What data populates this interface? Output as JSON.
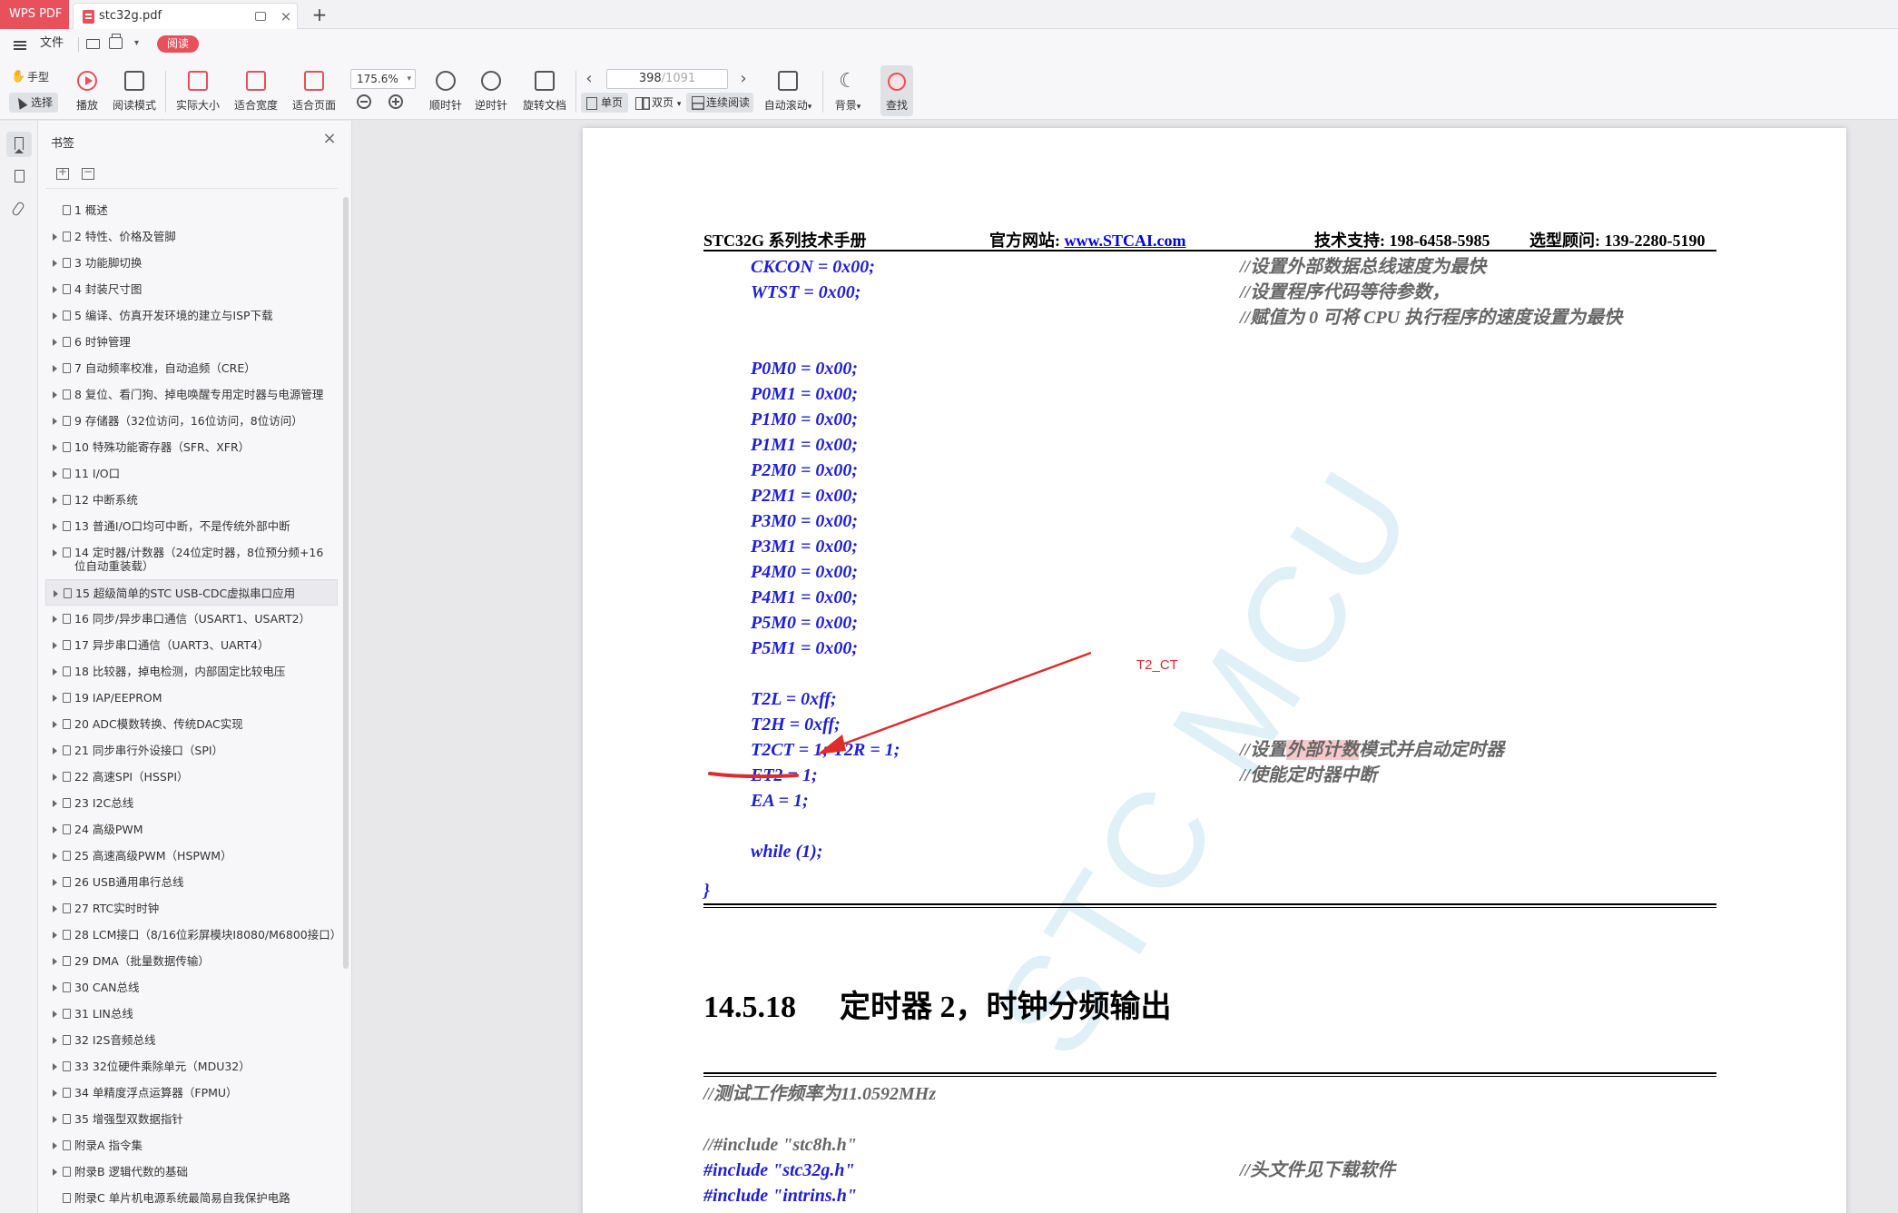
{
  "titlebar": {
    "app_tab": "WPS PDF",
    "doc_tab": "stc32g.pdf",
    "close_glyph": "×",
    "new_tab_glyph": "+"
  },
  "menubar": {
    "file": "文件",
    "read_badge": "阅读"
  },
  "toolbar": {
    "hand": "手型",
    "select": "选择",
    "play": "播放",
    "read_mode": "阅读模式",
    "actual_size": "实际大小",
    "fit_width": "适合宽度",
    "fit_page": "适合页面",
    "zoom_level": "175.6%",
    "rotate_cw": "顺时针",
    "rotate_ccw": "逆时针",
    "rotate_doc": "旋转文档",
    "current_page": "398",
    "total_pages": "/1091",
    "single_page": "单页",
    "double_page": "双页",
    "continuous": "连续阅读",
    "auto_scroll": "自动滚动",
    "background": "背景",
    "find": "查找",
    "dropdown_glyph": "▾",
    "prev_glyph": "‹",
    "next_glyph": "›"
  },
  "bookmarks": {
    "title": "书签",
    "close_glyph": "×",
    "items": [
      {
        "label": "1 概述",
        "expandable": false
      },
      {
        "label": "2 特性、价格及管脚",
        "expandable": true
      },
      {
        "label": "3 功能脚切换",
        "expandable": true
      },
      {
        "label": "4 封装尺寸图",
        "expandable": true
      },
      {
        "label": "5 编译、仿真开发环境的建立与ISP下载",
        "expandable": true
      },
      {
        "label": "6 时钟管理",
        "expandable": true
      },
      {
        "label": "7 自动频率校准，自动追频（CRE）",
        "expandable": true
      },
      {
        "label": "8 复位、看门狗、掉电唤醒专用定时器与电源管理",
        "expandable": true
      },
      {
        "label": "9 存储器（32位访问，16位访问，8位访问）",
        "expandable": true
      },
      {
        "label": "10 特殊功能寄存器（SFR、XFR）",
        "expandable": true
      },
      {
        "label": "11 I/O口",
        "expandable": true
      },
      {
        "label": "12 中断系统",
        "expandable": true
      },
      {
        "label": "13 普通I/O口均可中断，不是传统外部中断",
        "expandable": true
      },
      {
        "label": "14 定时器/计数器（24位定时器，8位预分频+16位自动重装载）",
        "expandable": true
      },
      {
        "label": "15 超级简单的STC USB-CDC虚拟串口应用",
        "expandable": true
      },
      {
        "label": "16 同步/异步串口通信（USART1、USART2）",
        "expandable": true
      },
      {
        "label": "17 异步串口通信（UART3、UART4）",
        "expandable": true
      },
      {
        "label": "18 比较器，掉电检测，内部固定比较电压",
        "expandable": true
      },
      {
        "label": "19 IAP/EEPROM",
        "expandable": true
      },
      {
        "label": "20 ADC模数转换、传统DAC实现",
        "expandable": true
      },
      {
        "label": "21 同步串行外设接口（SPI）",
        "expandable": true
      },
      {
        "label": "22 高速SPI（HSSPI）",
        "expandable": true
      },
      {
        "label": "23 I2C总线",
        "expandable": true
      },
      {
        "label": "24 高级PWM",
        "expandable": true
      },
      {
        "label": "25 高速高级PWM（HSPWM）",
        "expandable": true
      },
      {
        "label": "26 USB通用串行总线",
        "expandable": true
      },
      {
        "label": "27 RTC实时时钟",
        "expandable": true
      },
      {
        "label": "28 LCM接口（8/16位彩屏模块I8080/M6800接口）",
        "expandable": true
      },
      {
        "label": "29 DMA（批量数据传输）",
        "expandable": true
      },
      {
        "label": "30 CAN总线",
        "expandable": true
      },
      {
        "label": "31 LIN总线",
        "expandable": true
      },
      {
        "label": "32 I2S音频总线",
        "expandable": true
      },
      {
        "label": "33 32位硬件乘除单元（MDU32）",
        "expandable": true
      },
      {
        "label": "34 单精度浮点运算器（FPMU）",
        "expandable": true
      },
      {
        "label": "35 增强型双数据指针",
        "expandable": true
      },
      {
        "label": "附录A 指令集",
        "expandable": true
      },
      {
        "label": "附录B 逻辑代数的基础",
        "expandable": true
      },
      {
        "label": "附录C 单片机电源系统最简易自我保护电路",
        "expandable": false
      }
    ]
  },
  "document": {
    "header": {
      "title": "STC32G 系列技术手册",
      "website_label": "官方网站: ",
      "website_url": "www.STCAI.com",
      "support": "技术支持: 198-6458-5985",
      "advisor": "选型顾问: 139-2280-5190"
    },
    "code_lines": [
      {
        "code": "CKCON = 0x00;",
        "comment": "//设置外部数据总线速度为最快"
      },
      {
        "code": "WTST = 0x00;",
        "comment": "//设置程序代码等待参数，"
      },
      {
        "code": "",
        "comment": "//赋值为 0 可将 CPU 执行程序的速度设置为最快"
      },
      {
        "code": "P0M0 = 0x00;"
      },
      {
        "code": "P0M1 = 0x00;"
      },
      {
        "code": "P1M0 = 0x00;"
      },
      {
        "code": "P1M1 = 0x00;"
      },
      {
        "code": "P2M0 = 0x00;"
      },
      {
        "code": "P2M1 = 0x00;"
      },
      {
        "code": "P3M0 = 0x00;"
      },
      {
        "code": "P3M1 = 0x00;"
      },
      {
        "code": "P4M0 = 0x00;"
      },
      {
        "code": "P4M1 = 0x00;"
      },
      {
        "code": "P5M0 = 0x00;"
      },
      {
        "code": "P5M1 = 0x00;"
      },
      {
        "code": "T2L = 0xff;"
      },
      {
        "code": "T2H = 0xff;"
      },
      {
        "code": "T2CT = 1; T2R = 1;",
        "comment_pre": "//设置",
        "comment_hl": "外部计数",
        "comment_post": "模式并启动定时器"
      },
      {
        "code": "ET2 = 1;",
        "comment": "//使能定时器中断"
      },
      {
        "code": "EA = 1;"
      },
      {
        "code": "while (1);"
      }
    ],
    "closing_brace": "}",
    "section_number": "14.5.18",
    "section_title": "定时器 2，时钟分频输出",
    "test_comment": "//测试工作频率为11.0592MHz",
    "include_commented": "//#include \"stc8h.h\"",
    "include_main": "#include \"stc32g.h\"",
    "include_main_comment": "//头文件见下载软件",
    "include_intrins": "#include \"intrins.h\"",
    "annotation_label": "T2_CT",
    "watermark": "STC MCU",
    "colors": {
      "code": "#1f1fd6",
      "comment": "#666666",
      "annotation": "#e02b2b",
      "highlight": "#f7c9cc",
      "accent": "#e8505b"
    }
  }
}
